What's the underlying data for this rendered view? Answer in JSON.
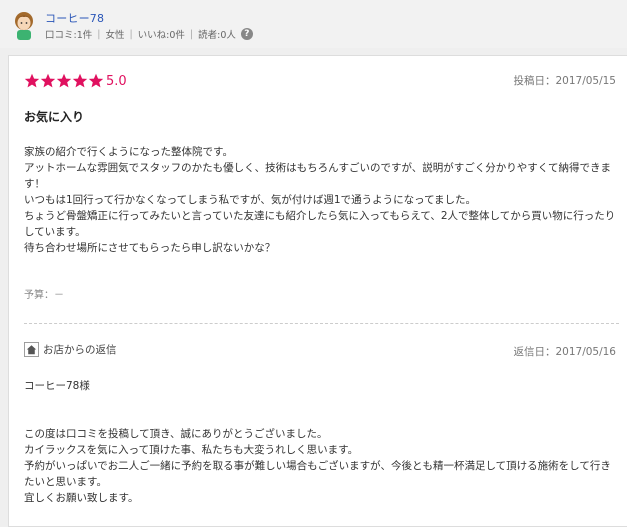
{
  "user": {
    "name": "コーヒー78",
    "reviews": "口コミ:1件",
    "gender": "女性",
    "likes": "いいね:0件",
    "readers": "読者:0人"
  },
  "review": {
    "rating_value": "5.0",
    "stars": 5,
    "date": "投稿日：2017/05/15",
    "title": "お気に入り",
    "lines": [
      "家族の紹介で行くようになった整体院です。",
      "アットホームな雰囲気でスタッフのかたも優しく、技術はもちろんすごいのですが、説明がすごく分かりやすくて納得できます！",
      "いつもは1回行って行かなくなってしまう私ですが、気が付けば週1で通うようになってました。",
      "ちょうど骨盤矯正に行ってみたいと言っていた友達にも紹介したら気に入ってもらえて、2人で整体してから買い物に行ったりしています。",
      "待ち合わせ場所にさせてもらったら申し訳ないかな？"
    ],
    "budget": "予算：－"
  },
  "reply": {
    "label": "お店からの返信",
    "date": "返信日：2017/05/16",
    "salutation": "コーヒー78様",
    "lines": [
      "この度は口コミを投稿して頂き、誠にありがとうございました。",
      "カイラックスを気に入って頂けた事、私たちも大変うれしく思います。",
      "予約がいっぱいでお二人ご一緒に予約を取る事が難しい場合もございますが、今後とも精一杯満足して頂ける施術をして行きたいと思います。",
      "宜しくお願い致します。"
    ]
  },
  "colors": {
    "accent_pink": "#e0115f",
    "link_blue": "#2a56b8"
  },
  "icons": {
    "avatar": "user-avatar",
    "help": "help-icon",
    "star": "star-icon",
    "home": "home-icon"
  }
}
